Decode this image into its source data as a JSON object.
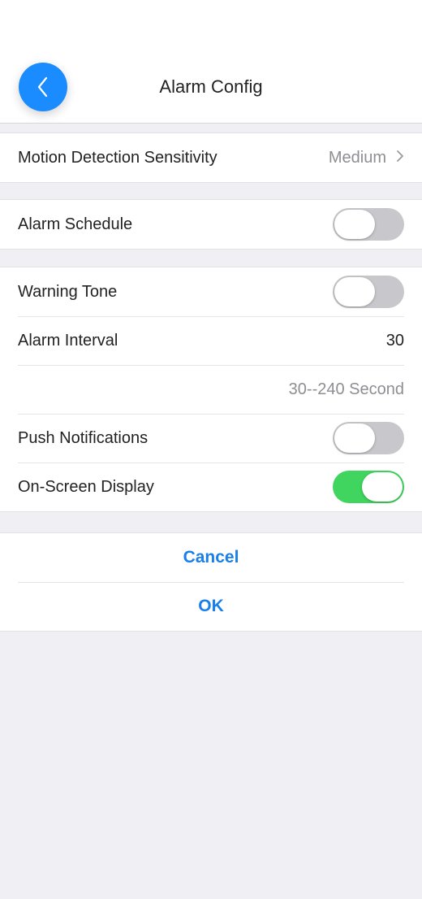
{
  "header": {
    "title": "Alarm Config",
    "back_icon": "chevron-left-icon"
  },
  "motion": {
    "label": "Motion Detection Sensitivity",
    "value": "Medium"
  },
  "schedule": {
    "label": "Alarm Schedule",
    "enabled": false
  },
  "settings": {
    "warning_tone": {
      "label": "Warning Tone",
      "enabled": false
    },
    "alarm_interval": {
      "label": "Alarm Interval",
      "value": "30"
    },
    "interval_hint": "30--240 Second",
    "push_notifications": {
      "label": "Push Notifications",
      "enabled": false
    },
    "osd": {
      "label": "On-Screen Display",
      "enabled": true
    }
  },
  "actions": {
    "cancel": "Cancel",
    "ok": "OK"
  },
  "colors": {
    "accent": "#1a8cff",
    "link": "#1a7fe8",
    "toggle_on": "#3fd55e",
    "toggle_off": "#c8c8cc",
    "background": "#efeff4"
  }
}
